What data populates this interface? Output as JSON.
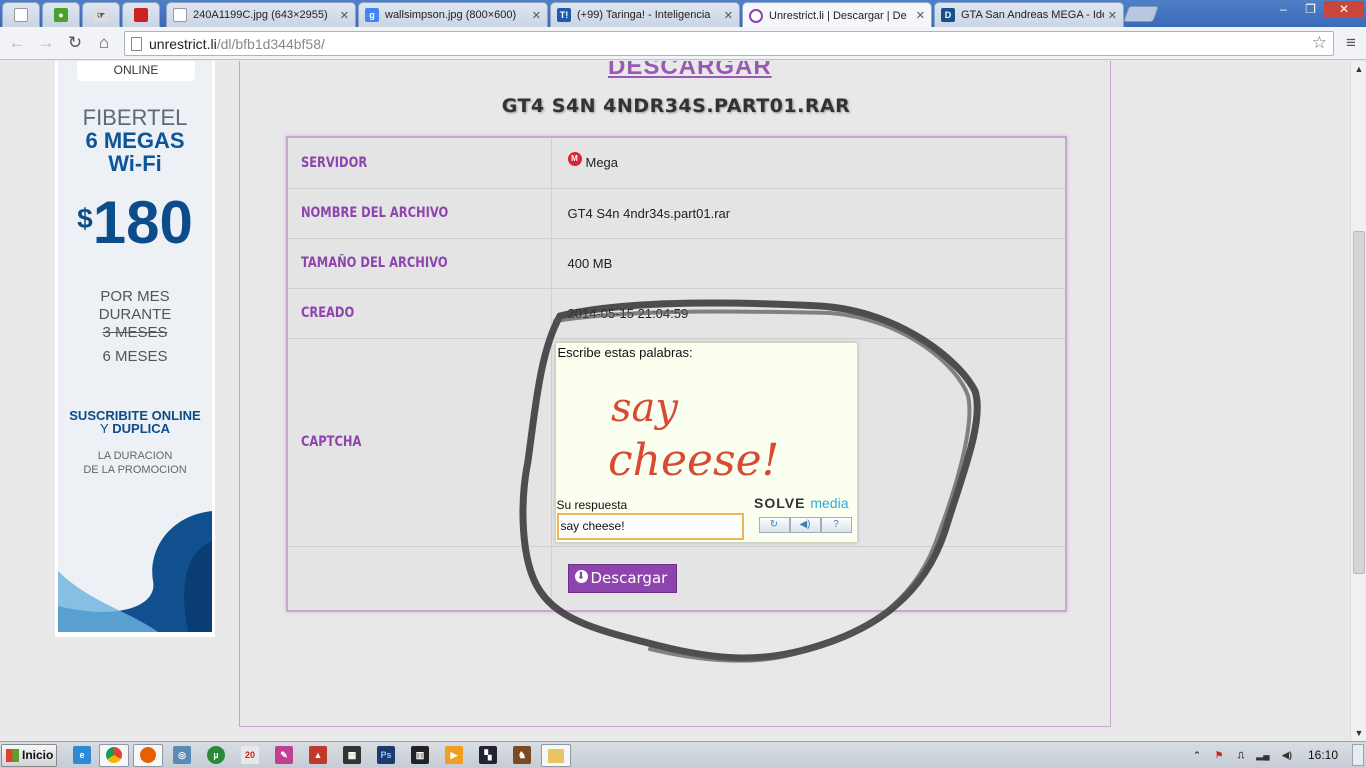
{
  "browser": {
    "tabs": [
      {
        "title": "",
        "icon": "blank-page-icon",
        "color": "#ffffff",
        "pinned": true
      },
      {
        "title": "",
        "icon": "green-app-icon",
        "color": "#4aa02c",
        "pinned": true
      },
      {
        "title": "",
        "icon": "cursor-app-icon",
        "color": "#555555",
        "pinned": true
      },
      {
        "title": "",
        "icon": "red-app-icon",
        "color": "#cc2222",
        "pinned": true
      },
      {
        "title": "240A1199C.jpg (643×2955)",
        "icon": "blank-page-icon",
        "color": "#ffffff"
      },
      {
        "title": "wallsimpson.jpg (800×600)",
        "icon": "google-icon",
        "color": "#4285f4"
      },
      {
        "title": "(+99) Taringa! - Inteligencia",
        "icon": "taringa-icon",
        "color": "#1d5ca8"
      },
      {
        "title": "Unrestrict.li | Descargar | De",
        "icon": "unrestrict-icon",
        "color": "#8e44ad",
        "active": true
      },
      {
        "title": "GTA San Andreas MEGA - Ide",
        "icon": "dotd-icon",
        "color": "#1a4e8c"
      }
    ],
    "url_host": "unrestrict.li",
    "url_path": "/dl/bfb1d344bf58/",
    "window_controls": [
      "–",
      "❐",
      "✕"
    ]
  },
  "ad": {
    "online": "ONLINE",
    "brand": "FIBERTEL",
    "megas": "6 MEGAS",
    "wifi": "Wi-Fi",
    "currency": "$",
    "price": "180",
    "por_mes": "POR MES",
    "durante": "DURANTE",
    "old_months": "3 MESES",
    "new_months": "6 MESES",
    "suscribite": "SUSCRIBITE ONLINE",
    "y": "Y",
    "duplica": "DUPLICA",
    "la_duracion": "LA DURACION",
    "de_la_promocion": "DE LA PROMOCION"
  },
  "page": {
    "heading": "DESCARGAR",
    "file_title": "GT4 S4N 4NDR34S.PART01.RAR",
    "rows": {
      "servidor_label": "SERVIDOR",
      "servidor_value": "Mega",
      "nombre_label": "NOMBRE DEL ARCHIVO",
      "nombre_value": "GT4 S4n 4ndr34s.part01.rar",
      "tamano_label": "TAMAÑO DEL ARCHIVO",
      "tamano_value": "400 MB",
      "creado_label": "CREADO",
      "creado_value": "2014-05-15 21:04:59",
      "captcha_label": "CAPTCHA"
    },
    "captcha": {
      "instruction": "Escribe estas palabras:",
      "word1": "say",
      "word2": "cheese!",
      "response_label": "Su respuesta",
      "response_value": "say cheese!",
      "brand_solve": "SOLVE",
      "brand_media": "media"
    },
    "download_button": "Descargar"
  },
  "taskbar": {
    "start": "Inicio",
    "clock": "16:10"
  }
}
